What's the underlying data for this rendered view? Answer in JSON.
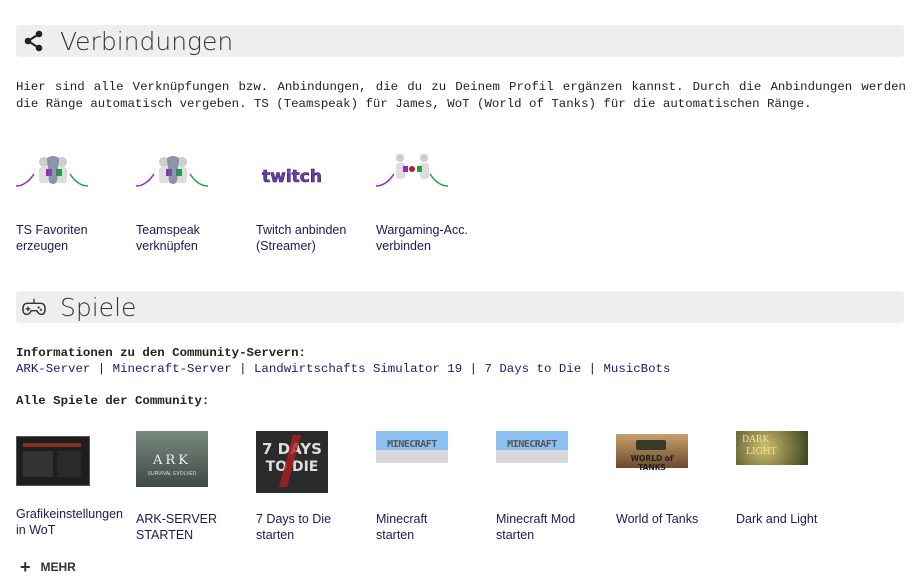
{
  "connections": {
    "title": "Verbindungen",
    "icon": "share-icon",
    "description": "Hier sind alle Verknüpfungen bzw. Anbindungen, die du zu Deinem Profil ergänzen kannst. Durch die Anbindungen werden die Ränge automatisch vergeben. TS (Teamspeak) für James, WoT (World of Tanks) für die automatischen Ränge.",
    "items": [
      {
        "label_line1": "TS Favoriten",
        "label_line2": "erzeugen",
        "icon": "ts-connect-icon"
      },
      {
        "label_line1": "Teamspeak",
        "label_line2": "verknüpfen",
        "icon": "ts-connect-icon"
      },
      {
        "label_line1": "Twitch anbinden",
        "label_line2": "(Streamer)",
        "icon": "twitch-logo",
        "logo_text": "twitch"
      },
      {
        "label_line1": "Wargaming-Acc.",
        "label_line2": "verbinden",
        "icon": "wargaming-connect-icon"
      }
    ]
  },
  "games": {
    "title": "Spiele",
    "icon": "gamepad-icon",
    "servers_heading": "Informationen zu den Community-Servern:",
    "servers": [
      "ARK-Server",
      "Minecraft-Server",
      "Landwirtschafts Simulator 19",
      "7 Days to Die",
      "MusicBots"
    ],
    "separator": "|",
    "all_games_heading": "Alle Spiele der Community:",
    "items": [
      {
        "label_line1": "Grafikeinstellungen",
        "label_line2": "in WoT",
        "thumb": "wot-settings-thumb"
      },
      {
        "label_line1": "ARK-SERVER",
        "label_line2": "STARTEN",
        "thumb": "ark-thumb",
        "logo_text": "ARK",
        "logo_sub": "SURVIVAL EVOLVED"
      },
      {
        "label_line1": "7 Days to Die",
        "label_line2": "starten",
        "thumb": "7dtd-thumb",
        "logo_text": "7 DAYS",
        "logo_sub": "TO DIE"
      },
      {
        "label_line1": "Minecraft",
        "label_line2": "starten",
        "thumb": "minecraft-thumb",
        "logo_text": "MINECRAFT"
      },
      {
        "label_line1": "Minecraft Mod",
        "label_line2": "starten",
        "thumb": "minecraft-thumb",
        "logo_text": "MINECRAFT"
      },
      {
        "label_line1": "World of Tanks",
        "label_line2": "",
        "thumb": "wot-thumb",
        "logo_text": "WORLD of TANKS"
      },
      {
        "label_line1": "Dark and Light",
        "label_line2": "",
        "thumb": "dark-light-thumb",
        "logo_text": "DARK",
        "logo_sub": "LIGHT"
      }
    ],
    "more_label": "MEHR"
  },
  "colors": {
    "header_bg": "#eeeeee",
    "link": "#1a1a77",
    "twitch": "#6441a5",
    "ts_purple": "#a020c0",
    "ts_green": "#20a040"
  }
}
